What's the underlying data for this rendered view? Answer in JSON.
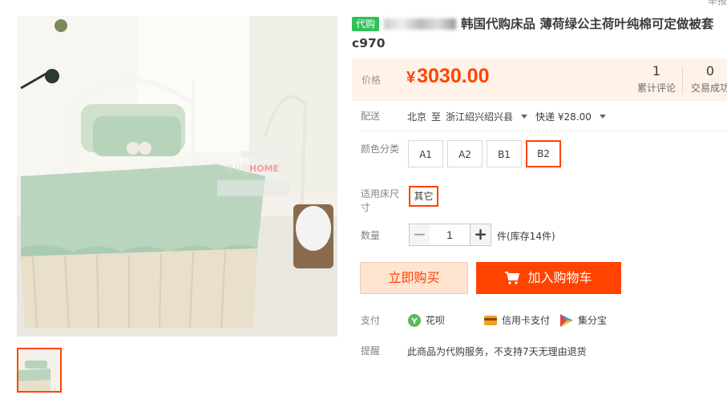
{
  "report_link": "举报",
  "title": {
    "tag": "代购",
    "text": "韩国代购床品 薄荷绿公主荷叶纯棉可定做被套c970"
  },
  "price": {
    "label": "价格",
    "currency": "¥",
    "value": "3030.00",
    "reviews_count": "1",
    "reviews_label": "累计评论",
    "deals_count": "0",
    "deals_label": "交易成功"
  },
  "delivery": {
    "label": "配送",
    "from": "北京",
    "to_word": "至",
    "to": "浙江绍兴绍兴县",
    "shipping": "快递 ¥28.00"
  },
  "color": {
    "label": "颜色分类",
    "options": [
      "A1",
      "A2",
      "B1",
      "B2"
    ],
    "selected": "B2"
  },
  "size": {
    "label": "适用床尺寸",
    "option": "其它"
  },
  "quantity": {
    "label": "数量",
    "value": "1",
    "minus": "−",
    "plus": "+",
    "stock": "件(库存14件)"
  },
  "buttons": {
    "buy_now": "立即购买",
    "add_cart": "加入购物车"
  },
  "payment": {
    "label": "支付",
    "methods": [
      "花呗",
      "信用卡支付",
      "集分宝"
    ]
  },
  "notice": {
    "label": "提醒",
    "text": "此商品为代购服务，不支持7天无理由退货"
  },
  "image_watermark": "HOME",
  "colors": {
    "accent": "#ff4400",
    "tag_green": "#2fc05a",
    "price_bg": "#fff2e8"
  }
}
